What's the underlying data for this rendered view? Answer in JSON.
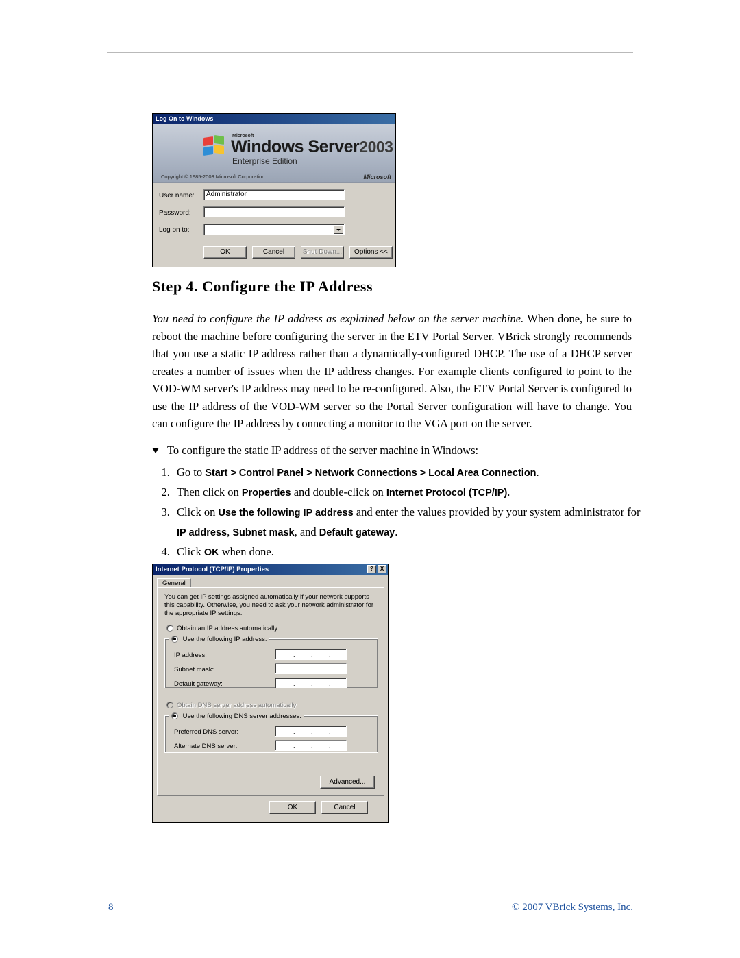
{
  "logon_dialog": {
    "title": "Log On to Windows",
    "banner": {
      "microsoft": "Microsoft",
      "product": "Windows Server",
      "year": "2003",
      "edition": "Enterprise Edition",
      "copyright": "Copyright © 1985-2003  Microsoft Corporation",
      "logo": "Microsoft"
    },
    "fields": [
      {
        "label": "User name:",
        "value": "Administrator"
      },
      {
        "label": "Password:",
        "value": ""
      },
      {
        "label": "Log on to:",
        "value": ""
      }
    ],
    "buttons": {
      "ok": "OK",
      "cancel": "Cancel",
      "shutdown": "Shut Down...",
      "options": "Options <<"
    }
  },
  "article": {
    "heading": "Step 4. Configure the IP Address",
    "intro_italic": "You need to configure the IP address as explained below on the server machine.",
    "intro_rest": " When done, be sure to reboot the machine before configuring the server in the ETV Portal Server. VBrick strongly recommends that you use a static IP address rather than a dynamically-configured DHCP. The use of a DHCP server creates a number of issues when the IP address changes. For example clients configured to point to the VOD-WM server's IP address may need to be re-configured. Also, the ETV Portal Server is configured to use the IP address of the VOD-WM server so the Portal Server configuration will have to change. You can configure the IP address by connecting a monitor to the VGA port on the server.",
    "procedure_heading": "To configure the static IP address of the server machine in Windows:",
    "steps": [
      {
        "pre": "Go to ",
        "bold": "Start > Control Panel > Network Connections > Local Area Connection",
        "post": "."
      },
      {
        "pre": "Then click on ",
        "bold": "Properties",
        "mid": " and double-click on ",
        "bold2": "Internet Protocol (TCP/IP)",
        "post": "."
      },
      {
        "pre": "Click on ",
        "bold": "Use the following IP address",
        "mid": " and enter the values provided by your system administrator for ",
        "bold2": "IP address",
        "mid2": ", ",
        "bold3": "Subnet mask",
        "mid3": ", and ",
        "bold4": "Default gateway",
        "post": "."
      },
      {
        "pre": "Click ",
        "bold": "OK",
        "post": " when done."
      }
    ]
  },
  "tcp_dialog": {
    "title": "Internet Protocol (TCP/IP) Properties",
    "title_buttons": {
      "help": "?",
      "close": "X"
    },
    "tab": "General",
    "description": "You can get IP settings assigned automatically if your network supports this capability. Otherwise, you need to ask your network administrator for the appropriate IP settings.",
    "radio_auto_ip": "Obtain an IP address automatically",
    "group_ip_legend": "Use the following IP address:",
    "ip_fields": [
      {
        "label": "IP address:",
        "value": ""
      },
      {
        "label": "Subnet mask:",
        "value": ""
      },
      {
        "label": "Default gateway:",
        "value": ""
      }
    ],
    "radio_auto_dns": "Obtain DNS server address automatically",
    "group_dns_legend": "Use the following DNS server addresses:",
    "dns_fields": [
      {
        "label": "Preferred DNS server:",
        "value": ""
      },
      {
        "label": "Alternate DNS server:",
        "value": ""
      }
    ],
    "advanced_button": "Advanced...",
    "buttons": {
      "ok": "OK",
      "cancel": "Cancel"
    }
  },
  "footer": {
    "page_number": "8",
    "copyright": "© 2007 VBrick Systems, Inc.",
    "link_color": "#1b4f9c"
  }
}
